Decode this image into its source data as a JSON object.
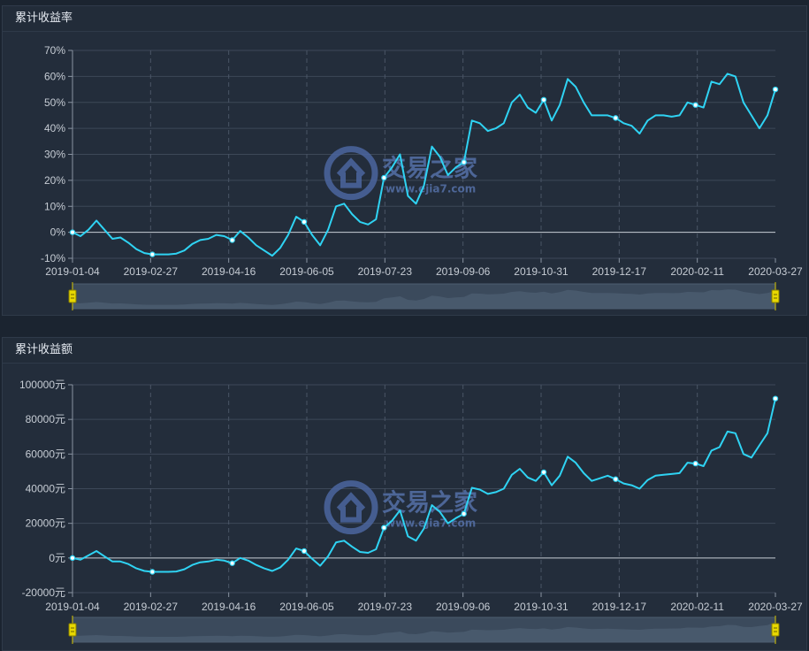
{
  "chart_data": [
    {
      "type": "line",
      "title": "累计收益率",
      "y_tick_labels": [
        "70%",
        "60%",
        "50%",
        "40%",
        "30%",
        "20%",
        "10%",
        "0%",
        "-10%"
      ],
      "ylim": [
        -10,
        70
      ],
      "x_tick_labels": [
        "2019-01-04",
        "2019-02-27",
        "2019-04-16",
        "2019-06-05",
        "2019-07-23",
        "2019-09-06",
        "2019-10-31",
        "2019-12-17",
        "2020-02-11",
        "2020-03-27"
      ],
      "grid": true,
      "series": [
        {
          "values": [
            0,
            -1.5,
            1,
            4.5,
            1,
            -2.5,
            -2,
            -4,
            -6.5,
            -8,
            -8.5,
            -8.5,
            -8.5,
            -8.2,
            -7,
            -4.5,
            -3,
            -2.5,
            -1,
            -1.5,
            -3,
            0.5,
            -2,
            -5,
            -7,
            -9,
            -6,
            -1,
            6,
            4,
            -1,
            -5,
            1,
            10,
            11,
            7,
            4,
            3,
            5,
            21,
            25,
            30,
            14,
            11,
            18,
            33,
            29,
            22,
            25,
            27,
            43,
            42,
            39,
            40,
            42,
            50,
            53,
            48,
            46,
            51,
            43,
            49,
            59,
            56,
            50,
            45,
            45,
            45,
            44,
            42,
            41,
            38,
            43,
            45,
            45,
            44.5,
            45,
            50,
            49,
            48,
            58,
            57,
            61,
            60,
            50,
            45,
            40,
            45,
            55
          ]
        }
      ],
      "markers_at_ticks": true,
      "watermark": "交易之家",
      "watermark_url": "www.ejia7.com"
    },
    {
      "type": "line",
      "title": "累计收益额",
      "y_tick_labels": [
        "100000元",
        "80000元",
        "60000元",
        "40000元",
        "20000元",
        "0元",
        "-20000元"
      ],
      "ylim": [
        -20000,
        100000
      ],
      "x_tick_labels": [
        "2019-01-04",
        "2019-02-27",
        "2019-04-16",
        "2019-06-05",
        "2019-07-23",
        "2019-09-06",
        "2019-10-31",
        "2019-12-17",
        "2020-02-11",
        "2020-03-27"
      ],
      "grid": true,
      "series": [
        {
          "values": [
            0,
            -1000,
            1500,
            4000,
            1000,
            -2000,
            -2000,
            -3500,
            -6000,
            -7500,
            -8000,
            -8000,
            -8000,
            -7800,
            -6500,
            -4000,
            -2500,
            -2000,
            -1000,
            -1500,
            -3000,
            0,
            -1500,
            -4000,
            -6000,
            -7500,
            -5500,
            -1000,
            5500,
            4000,
            -500,
            -4500,
            1000,
            9000,
            10000,
            6500,
            3500,
            3000,
            5000,
            17500,
            21500,
            27500,
            12500,
            10000,
            17000,
            30500,
            26500,
            20000,
            23000,
            25500,
            40500,
            39500,
            37000,
            38000,
            40000,
            48000,
            51500,
            46500,
            44500,
            49500,
            42000,
            47500,
            58500,
            55000,
            49000,
            44500,
            46000,
            47500,
            45500,
            43000,
            42000,
            40000,
            45000,
            47500,
            48000,
            48500,
            49000,
            55000,
            54500,
            53000,
            62000,
            64000,
            73000,
            72000,
            60000,
            58000,
            65000,
            72000,
            92000
          ]
        }
      ],
      "markers_at_ticks": true,
      "watermark": "交易之家",
      "watermark_url": "www.ejia7.com"
    }
  ]
}
